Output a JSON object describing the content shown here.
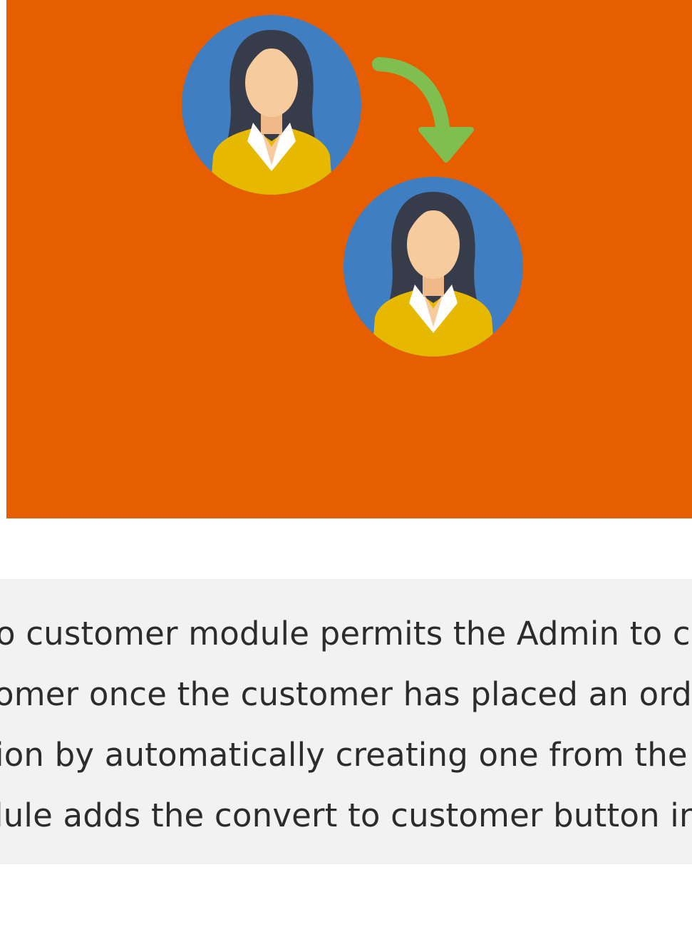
{
  "colors": {
    "hero_background": "#e65e00",
    "avatar_circle": "#3f7ec1",
    "hair": "#373c4a",
    "skin": "#f6cb9e",
    "shirt": "#e6b800",
    "collar": "#ffffff",
    "arrow": "#80be4f",
    "description_background": "#f2f2f2",
    "text": "#2c2c2c"
  },
  "hero": {
    "icons": {
      "source_avatar": "guest-avatar-icon",
      "target_avatar": "customer-avatar-icon",
      "conversion_arrow": "curved-arrow-down-icon"
    }
  },
  "description": {
    "lines": [
      "o customer module permits the Admin to co",
      "omer once the customer has placed an orde",
      "ion by automatically creating one from the c",
      "lule adds the convert to customer button in"
    ]
  }
}
